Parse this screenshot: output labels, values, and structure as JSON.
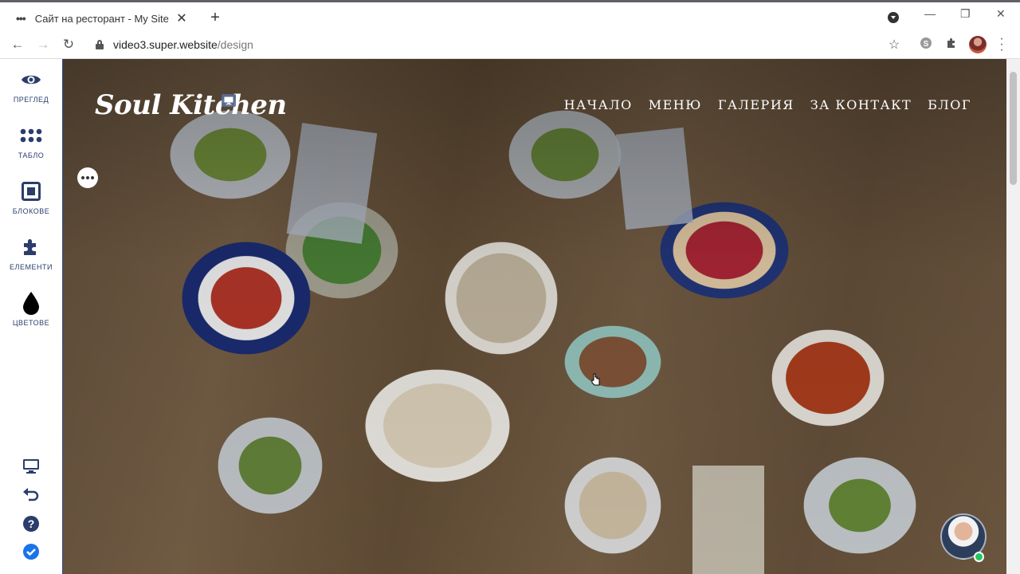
{
  "browser": {
    "tab_title": "Сайт на ресторант - My Site",
    "url_host": "video3.super.website",
    "url_path": "/design"
  },
  "sidebar": {
    "items": [
      {
        "label": "ПРЕГЛЕД",
        "icon": "eye-icon"
      },
      {
        "label": "ТАБЛО",
        "icon": "dashboard-grid-icon"
      },
      {
        "label": "БЛОКОВЕ",
        "icon": "blocks-icon"
      },
      {
        "label": "ЕЛЕМЕНТИ",
        "icon": "puzzle-icon"
      },
      {
        "label": "ЦВЕТОВЕ",
        "icon": "drop-icon"
      }
    ],
    "bottom_icons": [
      "monitor-icon",
      "undo-icon",
      "help-icon",
      "check-circle-icon"
    ]
  },
  "site": {
    "logo": "Soul Kitchen",
    "nav": [
      "НАЧАЛО",
      "МЕНЮ",
      "ГАЛЕРИЯ",
      "ЗА КОНТАКТ",
      "БЛОГ"
    ]
  },
  "colors": {
    "sidebar_text": "#2a3d6b",
    "accent_blue": "#1a73e8",
    "online": "#22c55e"
  }
}
